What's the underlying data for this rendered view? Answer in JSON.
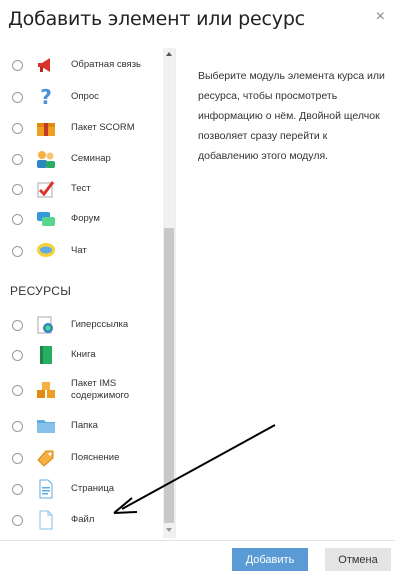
{
  "dialog": {
    "title": "Добавить элемент или ресурс",
    "close_glyph": "×"
  },
  "activities": [
    {
      "label": "Обратная связь",
      "icon": "megaphone-icon"
    },
    {
      "label": "Опрос",
      "icon": "question-icon"
    },
    {
      "label": "Пакет SCORM",
      "icon": "package-icon"
    },
    {
      "label": "Семинар",
      "icon": "workshop-icon"
    },
    {
      "label": "Тест",
      "icon": "checkmark-icon"
    },
    {
      "label": "Форум",
      "icon": "forum-icon"
    },
    {
      "label": "Чат",
      "icon": "chat-icon"
    }
  ],
  "resources_section": {
    "title": "РЕСУРСЫ"
  },
  "resources": [
    {
      "label": "Гиперссылка",
      "icon": "globe-link-icon"
    },
    {
      "label": "Книга",
      "icon": "book-icon"
    },
    {
      "label": "Пакет IMS содержимого",
      "icon": "ims-package-icon"
    },
    {
      "label": "Папка",
      "icon": "folder-icon"
    },
    {
      "label": "Пояснение",
      "icon": "label-tag-icon"
    },
    {
      "label": "Страница",
      "icon": "page-icon"
    },
    {
      "label": "Файл",
      "icon": "file-icon"
    }
  ],
  "info_text": "Выберите модуль элемента курса или ресурса, чтобы просмотреть информацию о нём. Двойной щелчок позволяет сразу перейти к добавлению этого модуля.",
  "footer": {
    "add_label": "Добавить",
    "cancel_label": "Отмена"
  }
}
